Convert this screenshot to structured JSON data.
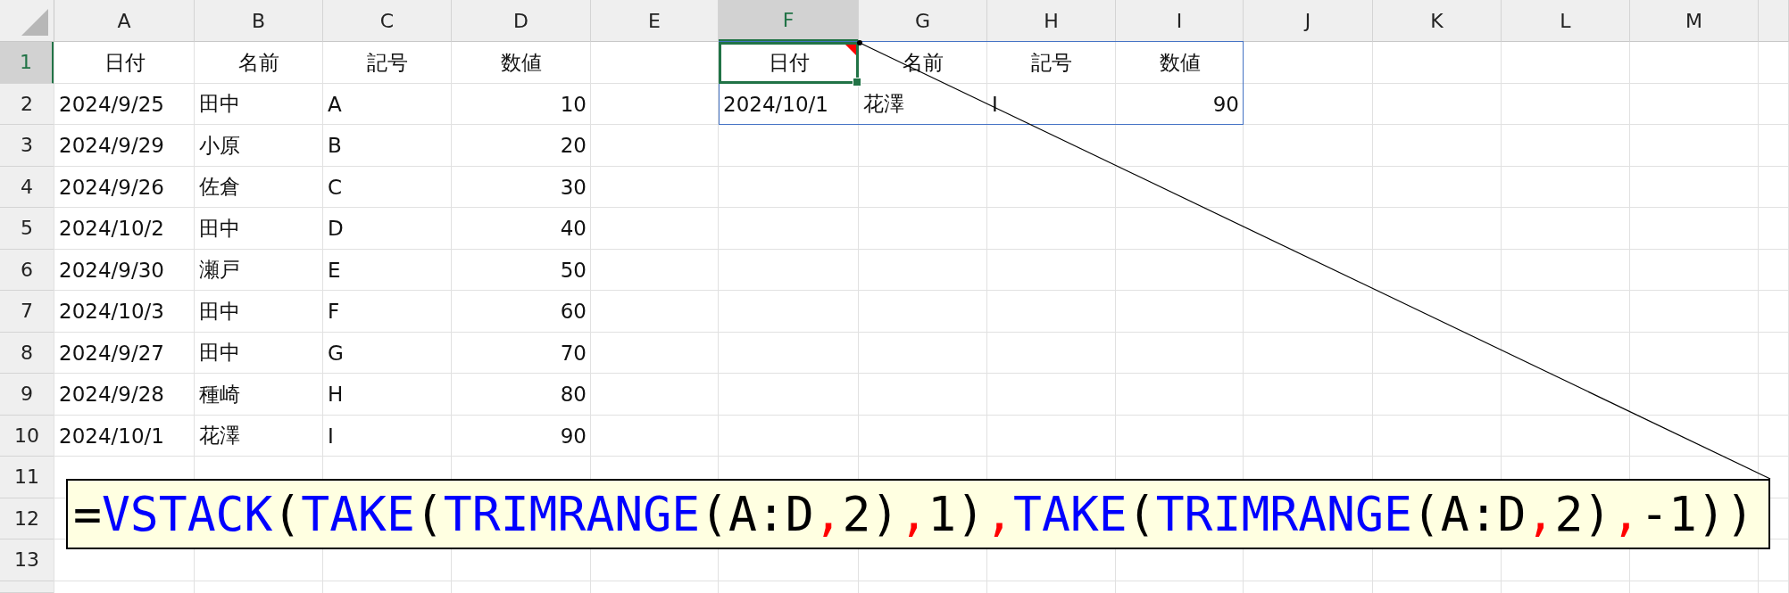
{
  "column_headers": [
    {
      "label": "A",
      "selected": false
    },
    {
      "label": "B",
      "selected": false
    },
    {
      "label": "C",
      "selected": false
    },
    {
      "label": "D",
      "selected": false
    },
    {
      "label": "E",
      "selected": false
    },
    {
      "label": "F",
      "selected": true
    },
    {
      "label": "G",
      "selected": false
    },
    {
      "label": "H",
      "selected": false
    },
    {
      "label": "I",
      "selected": false
    },
    {
      "label": "J",
      "selected": false
    },
    {
      "label": "K",
      "selected": false
    },
    {
      "label": "L",
      "selected": false
    },
    {
      "label": "M",
      "selected": false
    }
  ],
  "row_headers": [
    {
      "label": "1",
      "selected": true
    },
    {
      "label": "2",
      "selected": false
    },
    {
      "label": "3",
      "selected": false
    },
    {
      "label": "4",
      "selected": false
    },
    {
      "label": "5",
      "selected": false
    },
    {
      "label": "6",
      "selected": false
    },
    {
      "label": "7",
      "selected": false
    },
    {
      "label": "8",
      "selected": false
    },
    {
      "label": "9",
      "selected": false
    },
    {
      "label": "10",
      "selected": false
    },
    {
      "label": "11",
      "selected": false
    },
    {
      "label": "12",
      "selected": false
    },
    {
      "label": "13",
      "selected": false
    }
  ],
  "source_table": {
    "columns": [
      {
        "header": "日付",
        "kind": "text",
        "selected": false,
        "comment": false
      },
      {
        "header": "名前",
        "kind": "text",
        "selected": false,
        "comment": false
      },
      {
        "header": "記号",
        "kind": "text",
        "selected": false,
        "comment": false
      },
      {
        "header": "数値",
        "kind": "number",
        "selected": false,
        "comment": false
      }
    ],
    "rows": [
      [
        "2024/9/25",
        "田中",
        "A",
        "10"
      ],
      [
        "2024/9/29",
        "小原",
        "B",
        "20"
      ],
      [
        "2024/9/26",
        "佐倉",
        "C",
        "30"
      ],
      [
        "2024/10/2",
        "田中",
        "D",
        "40"
      ],
      [
        "2024/9/30",
        "瀬戸",
        "E",
        "50"
      ],
      [
        "2024/10/3",
        "田中",
        "F",
        "60"
      ],
      [
        "2024/9/27",
        "田中",
        "G",
        "70"
      ],
      [
        "2024/9/28",
        "種崎",
        "H",
        "80"
      ],
      [
        "2024/10/1",
        "花澤",
        "I",
        "90"
      ]
    ]
  },
  "result_table": {
    "columns": [
      {
        "header": "日付",
        "kind": "text",
        "selected": true,
        "comment": true
      },
      {
        "header": "名前",
        "kind": "text",
        "selected": false,
        "comment": false
      },
      {
        "header": "記号",
        "kind": "text",
        "selected": false,
        "comment": false
      },
      {
        "header": "数値",
        "kind": "number",
        "selected": false,
        "comment": false
      }
    ],
    "rows": [
      [
        "2024/10/1",
        "花澤",
        "I",
        "90"
      ]
    ],
    "spill": true
  },
  "callout": {
    "segments": [
      {
        "kind": "plain",
        "text": "="
      },
      {
        "kind": "function",
        "text": "VSTACK"
      },
      {
        "kind": "plain",
        "text": "("
      },
      {
        "kind": "function",
        "text": "TAKE"
      },
      {
        "kind": "plain",
        "text": "("
      },
      {
        "kind": "function",
        "text": "TRIMRANGE"
      },
      {
        "kind": "plain",
        "text": "(A:D"
      },
      {
        "kind": "separator",
        "text": ","
      },
      {
        "kind": "plain",
        "text": "2)"
      },
      {
        "kind": "separator",
        "text": ","
      },
      {
        "kind": "plain",
        "text": "1)"
      },
      {
        "kind": "separator",
        "text": ","
      },
      {
        "kind": "function",
        "text": "TAKE"
      },
      {
        "kind": "plain",
        "text": "("
      },
      {
        "kind": "function",
        "text": "TRIMRANGE"
      },
      {
        "kind": "plain",
        "text": "(A:D"
      },
      {
        "kind": "separator",
        "text": ","
      },
      {
        "kind": "plain",
        "text": "2)"
      },
      {
        "kind": "separator",
        "text": ","
      },
      {
        "kind": "plain",
        "text": "-1))"
      }
    ]
  }
}
